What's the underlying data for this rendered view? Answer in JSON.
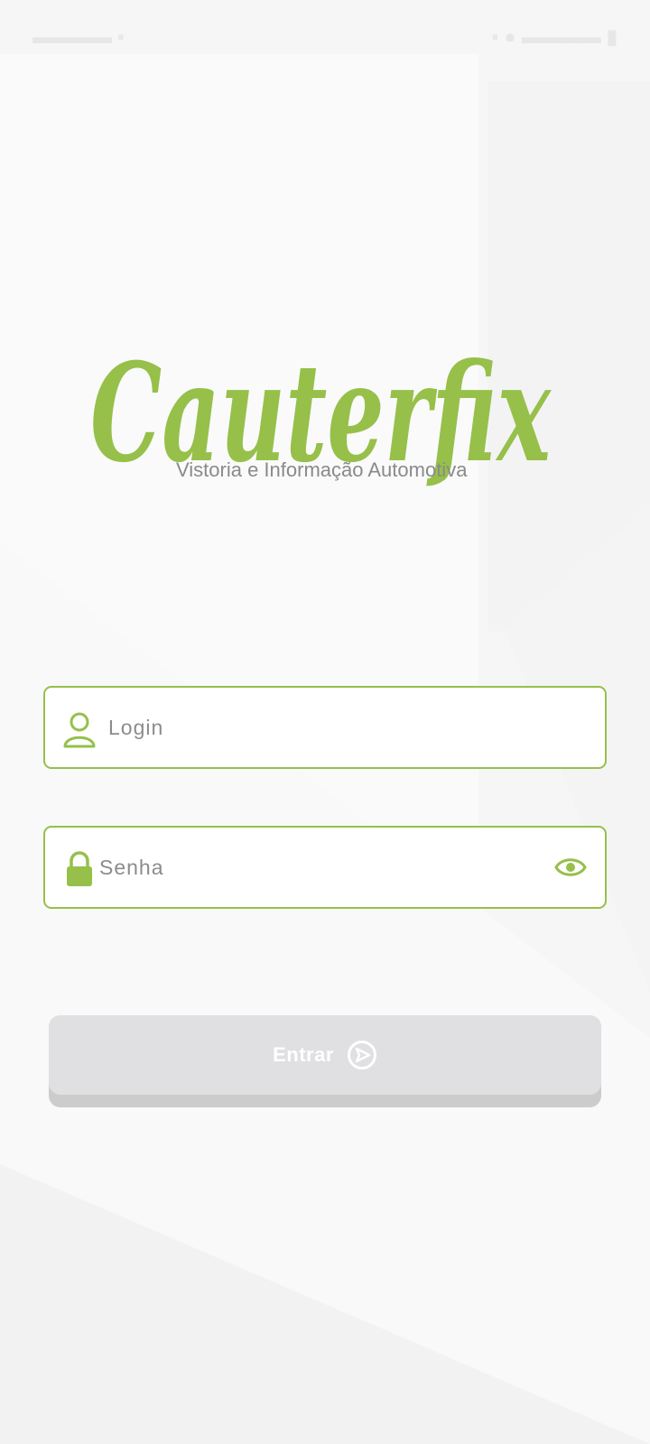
{
  "brand": {
    "name": "Cauterfix",
    "tagline": "Vistoria e Informação Automotiva",
    "accent_color": "#96c04a"
  },
  "form": {
    "login": {
      "placeholder": "Login",
      "icon": "user-icon"
    },
    "password": {
      "placeholder": "Senha",
      "icon": "lock-icon",
      "toggle_icon": "eye-icon"
    },
    "submit": {
      "label": "Entrar",
      "icon": "send-circle-icon"
    }
  }
}
